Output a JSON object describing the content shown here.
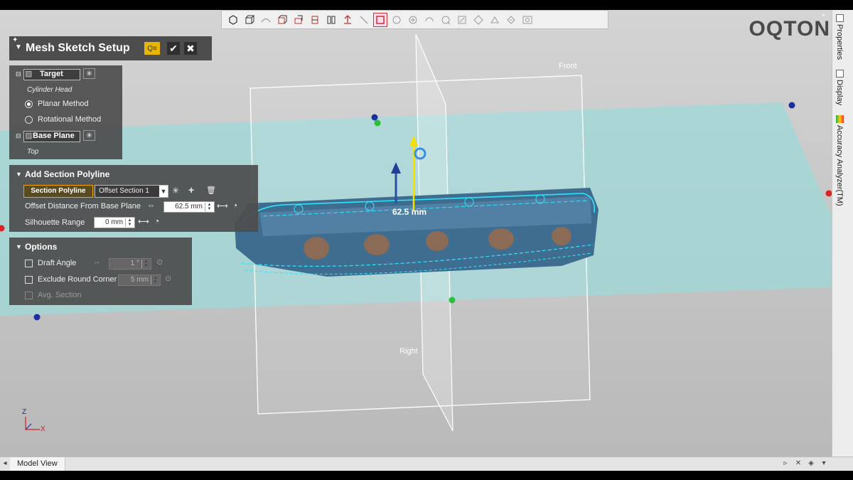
{
  "logo": "OQTON",
  "viewport": {
    "label_front": "Front",
    "label_right": "Right",
    "dimension": "62.5 mm",
    "axis_z": "Z",
    "axis_x": "X"
  },
  "toolbar": {
    "icons": [
      "sketch-icon",
      "box-icon",
      "surface-icon",
      "view-cube-icon",
      "plane-icon",
      "plane-flip-icon",
      "split-icon",
      "align-icon",
      "line-icon",
      "rectangle-select-icon",
      "circle-icon",
      "circle-add-icon",
      "circle-arc-icon",
      "circle-arrow-icon",
      "edit-icon",
      "shape-icon",
      "dimension-icon",
      "constraint-icon",
      "visibility-icon"
    ]
  },
  "setup_panel": {
    "title": "Mesh Sketch Setup",
    "target_label": "Target",
    "target_value": "Cylinder Head",
    "planar_method": "Planar Method",
    "rotational_method": "Rotational Method",
    "base_plane_label": "Base Plane",
    "base_plane_value": "Top"
  },
  "section_panel": {
    "title": "Add Section Polyline",
    "polyline_button": "Section Polyline",
    "offset_select": "Offset Section 1",
    "offset_distance_label": "Offset Distance From Base Plane",
    "offset_distance_value": "62.5 mm",
    "silhouette_label": "Silhouette Range",
    "silhouette_value": "0 mm"
  },
  "options_panel": {
    "title": "Options",
    "draft_angle_label": "Draft Angle",
    "draft_angle_value": "1 °",
    "exclude_round_label": "Exclude Round Corner",
    "exclude_round_value": "5 mm",
    "avg_section_label": "Avg. Section"
  },
  "sidebar": {
    "tabs": [
      "Properties",
      "Display",
      "Accuracy Analyzer(TM)"
    ]
  },
  "status": {
    "model_view": "Model View"
  }
}
